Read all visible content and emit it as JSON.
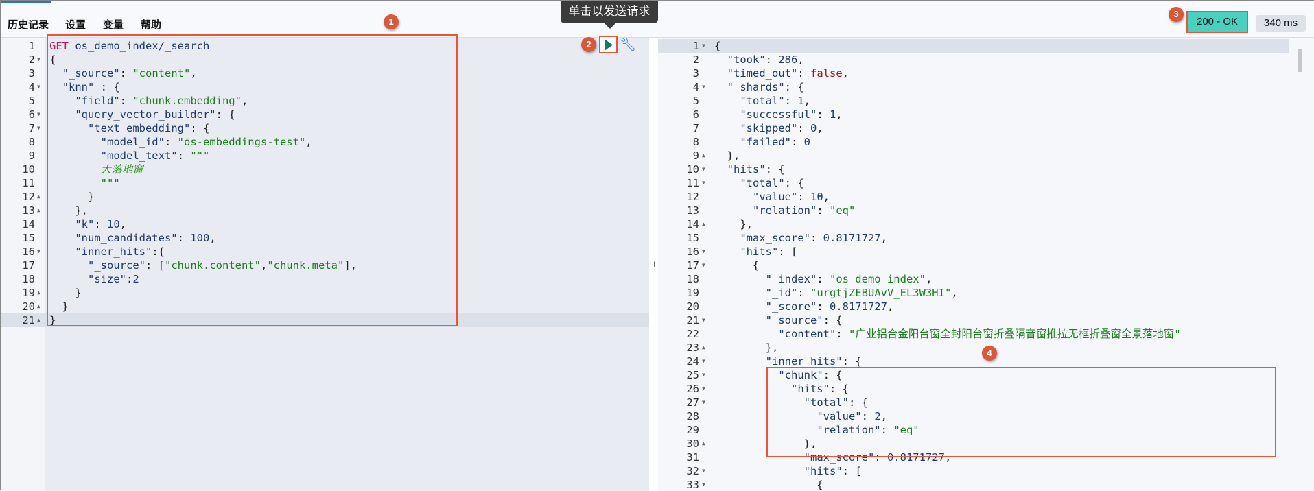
{
  "menu": {
    "history": "历史记录",
    "settings": "设置",
    "variables": "变量",
    "help": "帮助"
  },
  "tooltip": "单击以发送请求",
  "status": {
    "code": "200 - OK",
    "time": "340 ms",
    "color": "#48d1c0"
  },
  "badges": [
    "1",
    "2",
    "3",
    "4"
  ],
  "request": [
    {
      "n": "1",
      "tokens": [
        [
          "m",
          "GET"
        ],
        [
          "p",
          " "
        ],
        [
          "u",
          "os_demo_index/_search"
        ]
      ]
    },
    {
      "n": "2",
      "fold": "open",
      "tokens": [
        [
          "p",
          "{"
        ]
      ]
    },
    {
      "n": "3",
      "tokens": [
        [
          "p",
          "  "
        ],
        [
          "k",
          "\"_source\""
        ],
        [
          "p",
          ": "
        ],
        [
          "s",
          "\"content\""
        ],
        [
          "p",
          ","
        ]
      ]
    },
    {
      "n": "4",
      "fold": "open",
      "tokens": [
        [
          "p",
          "  "
        ],
        [
          "k",
          "\"knn\""
        ],
        [
          "p",
          " : {"
        ]
      ]
    },
    {
      "n": "5",
      "tokens": [
        [
          "p",
          "    "
        ],
        [
          "k",
          "\"field\""
        ],
        [
          "p",
          ": "
        ],
        [
          "s",
          "\"chunk.embedding\""
        ],
        [
          "p",
          ","
        ]
      ]
    },
    {
      "n": "6",
      "fold": "open",
      "tokens": [
        [
          "p",
          "    "
        ],
        [
          "k",
          "\"query_vector_builder\""
        ],
        [
          "p",
          ": {"
        ]
      ]
    },
    {
      "n": "7",
      "fold": "open",
      "tokens": [
        [
          "p",
          "      "
        ],
        [
          "k",
          "\"text_embedding\""
        ],
        [
          "p",
          ": {"
        ]
      ]
    },
    {
      "n": "8",
      "tokens": [
        [
          "p",
          "        "
        ],
        [
          "k",
          "\"model_id\""
        ],
        [
          "p",
          ": "
        ],
        [
          "s",
          "\"os-embeddings-test\""
        ],
        [
          "p",
          ","
        ]
      ]
    },
    {
      "n": "9",
      "tokens": [
        [
          "p",
          "        "
        ],
        [
          "k",
          "\"model_text\""
        ],
        [
          "p",
          ": "
        ],
        [
          "s",
          "\"\"\""
        ]
      ]
    },
    {
      "n": "10",
      "tokens": [
        [
          "p",
          "        "
        ],
        [
          "i",
          "大落地窗"
        ]
      ]
    },
    {
      "n": "11",
      "tokens": [
        [
          "p",
          "        "
        ],
        [
          "s",
          "\"\"\""
        ]
      ]
    },
    {
      "n": "12",
      "fold": "close",
      "tokens": [
        [
          "p",
          "      }"
        ]
      ]
    },
    {
      "n": "13",
      "fold": "close",
      "tokens": [
        [
          "p",
          "    },"
        ]
      ]
    },
    {
      "n": "14",
      "tokens": [
        [
          "p",
          "    "
        ],
        [
          "k",
          "\"k\""
        ],
        [
          "p",
          ": "
        ],
        [
          "n",
          "10"
        ],
        [
          "p",
          ","
        ]
      ]
    },
    {
      "n": "15",
      "tokens": [
        [
          "p",
          "    "
        ],
        [
          "k",
          "\"num_candidates\""
        ],
        [
          "p",
          ": "
        ],
        [
          "n",
          "100"
        ],
        [
          "p",
          ","
        ]
      ]
    },
    {
      "n": "16",
      "fold": "open",
      "tokens": [
        [
          "p",
          "    "
        ],
        [
          "k",
          "\"inner_hits\""
        ],
        [
          "p",
          ":{"
        ]
      ]
    },
    {
      "n": "17",
      "tokens": [
        [
          "p",
          "      "
        ],
        [
          "k",
          "\"_source\""
        ],
        [
          "p",
          ": ["
        ],
        [
          "s",
          "\"chunk.content\""
        ],
        [
          "p",
          ","
        ],
        [
          "s",
          "\"chunk.meta\""
        ],
        [
          "p",
          "],"
        ]
      ]
    },
    {
      "n": "18",
      "tokens": [
        [
          "p",
          "      "
        ],
        [
          "k",
          "\"size\""
        ],
        [
          "p",
          ":"
        ],
        [
          "n",
          "2"
        ]
      ]
    },
    {
      "n": "19",
      "fold": "close",
      "tokens": [
        [
          "p",
          "    }"
        ]
      ]
    },
    {
      "n": "20",
      "fold": "close",
      "tokens": [
        [
          "p",
          "  }"
        ]
      ]
    },
    {
      "n": "21",
      "fold": "close",
      "active": true,
      "tokens": [
        [
          "p",
          "}"
        ]
      ]
    }
  ],
  "response": [
    {
      "n": "1",
      "fold": "open",
      "active": true,
      "tokens": [
        [
          "p",
          "{"
        ]
      ]
    },
    {
      "n": "2",
      "tokens": [
        [
          "p",
          "  "
        ],
        [
          "k",
          "\"took\""
        ],
        [
          "p",
          ": "
        ],
        [
          "n",
          "286"
        ],
        [
          "p",
          ","
        ]
      ]
    },
    {
      "n": "3",
      "tokens": [
        [
          "p",
          "  "
        ],
        [
          "k",
          "\"timed_out\""
        ],
        [
          "p",
          ": "
        ],
        [
          "b",
          "false"
        ],
        [
          "p",
          ","
        ]
      ]
    },
    {
      "n": "4",
      "fold": "open",
      "tokens": [
        [
          "p",
          "  "
        ],
        [
          "k",
          "\"_shards\""
        ],
        [
          "p",
          ": {"
        ]
      ]
    },
    {
      "n": "5",
      "tokens": [
        [
          "p",
          "    "
        ],
        [
          "k",
          "\"total\""
        ],
        [
          "p",
          ": "
        ],
        [
          "n",
          "1"
        ],
        [
          "p",
          ","
        ]
      ]
    },
    {
      "n": "6",
      "tokens": [
        [
          "p",
          "    "
        ],
        [
          "k",
          "\"successful\""
        ],
        [
          "p",
          ": "
        ],
        [
          "n",
          "1"
        ],
        [
          "p",
          ","
        ]
      ]
    },
    {
      "n": "7",
      "tokens": [
        [
          "p",
          "    "
        ],
        [
          "k",
          "\"skipped\""
        ],
        [
          "p",
          ": "
        ],
        [
          "n",
          "0"
        ],
        [
          "p",
          ","
        ]
      ]
    },
    {
      "n": "8",
      "tokens": [
        [
          "p",
          "    "
        ],
        [
          "k",
          "\"failed\""
        ],
        [
          "p",
          ": "
        ],
        [
          "n",
          "0"
        ]
      ]
    },
    {
      "n": "9",
      "fold": "close",
      "tokens": [
        [
          "p",
          "  },"
        ]
      ]
    },
    {
      "n": "10",
      "fold": "open",
      "tokens": [
        [
          "p",
          "  "
        ],
        [
          "k",
          "\"hits\""
        ],
        [
          "p",
          ": {"
        ]
      ]
    },
    {
      "n": "11",
      "fold": "open",
      "tokens": [
        [
          "p",
          "    "
        ],
        [
          "k",
          "\"total\""
        ],
        [
          "p",
          ": {"
        ]
      ]
    },
    {
      "n": "12",
      "tokens": [
        [
          "p",
          "      "
        ],
        [
          "k",
          "\"value\""
        ],
        [
          "p",
          ": "
        ],
        [
          "n",
          "10"
        ],
        [
          "p",
          ","
        ]
      ]
    },
    {
      "n": "13",
      "tokens": [
        [
          "p",
          "      "
        ],
        [
          "k",
          "\"relation\""
        ],
        [
          "p",
          ": "
        ],
        [
          "s",
          "\"eq\""
        ]
      ]
    },
    {
      "n": "14",
      "fold": "close",
      "tokens": [
        [
          "p",
          "    },"
        ]
      ]
    },
    {
      "n": "15",
      "tokens": [
        [
          "p",
          "    "
        ],
        [
          "k",
          "\"max_score\""
        ],
        [
          "p",
          ": "
        ],
        [
          "n",
          "0.8171727"
        ],
        [
          "p",
          ","
        ]
      ]
    },
    {
      "n": "16",
      "fold": "open",
      "tokens": [
        [
          "p",
          "    "
        ],
        [
          "k",
          "\"hits\""
        ],
        [
          "p",
          ": ["
        ]
      ]
    },
    {
      "n": "17",
      "fold": "open",
      "tokens": [
        [
          "p",
          "      {"
        ]
      ]
    },
    {
      "n": "18",
      "tokens": [
        [
          "p",
          "        "
        ],
        [
          "k",
          "\"_index\""
        ],
        [
          "p",
          ": "
        ],
        [
          "s",
          "\"os_demo_index\""
        ],
        [
          "p",
          ","
        ]
      ]
    },
    {
      "n": "19",
      "tokens": [
        [
          "p",
          "        "
        ],
        [
          "k",
          "\"_id\""
        ],
        [
          "p",
          ": "
        ],
        [
          "s",
          "\"urgtjZEBUAvV_EL3W3HI\""
        ],
        [
          "p",
          ","
        ]
      ]
    },
    {
      "n": "20",
      "tokens": [
        [
          "p",
          "        "
        ],
        [
          "k",
          "\"_score\""
        ],
        [
          "p",
          ": "
        ],
        [
          "n",
          "0.8171727"
        ],
        [
          "p",
          ","
        ]
      ]
    },
    {
      "n": "21",
      "fold": "open",
      "tokens": [
        [
          "p",
          "        "
        ],
        [
          "k",
          "\"_source\""
        ],
        [
          "p",
          ": {"
        ]
      ]
    },
    {
      "n": "22",
      "tokens": [
        [
          "p",
          "          "
        ],
        [
          "k",
          "\"content\""
        ],
        [
          "p",
          ": "
        ],
        [
          "s",
          "\"广业铝合金阳台窗全封阳台窗折叠隔音窗推拉无框折叠窗全景落地窗\""
        ]
      ]
    },
    {
      "n": "23",
      "fold": "close",
      "tokens": [
        [
          "p",
          "        },"
        ]
      ]
    },
    {
      "n": "24",
      "fold": "open",
      "tokens": [
        [
          "p",
          "        "
        ],
        [
          "k",
          "\"inner_hits\""
        ],
        [
          "p",
          ": {"
        ]
      ]
    },
    {
      "n": "25",
      "fold": "open",
      "tokens": [
        [
          "p",
          "          "
        ],
        [
          "k",
          "\"chunk\""
        ],
        [
          "p",
          ": {"
        ]
      ]
    },
    {
      "n": "26",
      "fold": "open",
      "tokens": [
        [
          "p",
          "            "
        ],
        [
          "k",
          "\"hits\""
        ],
        [
          "p",
          ": {"
        ]
      ]
    },
    {
      "n": "27",
      "fold": "open",
      "tokens": [
        [
          "p",
          "              "
        ],
        [
          "k",
          "\"total\""
        ],
        [
          "p",
          ": {"
        ]
      ]
    },
    {
      "n": "28",
      "tokens": [
        [
          "p",
          "                "
        ],
        [
          "k",
          "\"value\""
        ],
        [
          "p",
          ": "
        ],
        [
          "n",
          "2"
        ],
        [
          "p",
          ","
        ]
      ]
    },
    {
      "n": "29",
      "tokens": [
        [
          "p",
          "                "
        ],
        [
          "k",
          "\"relation\""
        ],
        [
          "p",
          ": "
        ],
        [
          "s",
          "\"eq\""
        ]
      ]
    },
    {
      "n": "30",
      "fold": "close",
      "tokens": [
        [
          "p",
          "              },"
        ]
      ]
    },
    {
      "n": "31",
      "tokens": [
        [
          "p",
          "              "
        ],
        [
          "k",
          "\"max_score\""
        ],
        [
          "p",
          ": "
        ],
        [
          "n",
          "0.8171727"
        ],
        [
          "p",
          ","
        ]
      ]
    },
    {
      "n": "32",
      "fold": "open",
      "tokens": [
        [
          "p",
          "              "
        ],
        [
          "k",
          "\"hits\""
        ],
        [
          "p",
          ": ["
        ]
      ]
    },
    {
      "n": "33",
      "fold": "open",
      "tokens": [
        [
          "p",
          "                {"
        ]
      ]
    }
  ]
}
